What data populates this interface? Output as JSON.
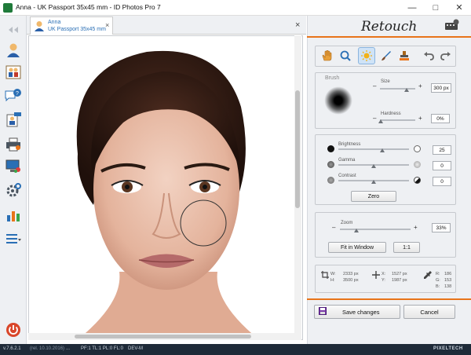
{
  "window": {
    "title": "Anna - UK Passport 35x45 mm - ID Photos Pro 7"
  },
  "tab": {
    "name": "Anna",
    "subtitle": "UK Passport 35x45 mm",
    "close": "×"
  },
  "canvas_close": "×",
  "panel": {
    "title": "Retouch",
    "brush": {
      "label": "Brush",
      "size_label": "Size",
      "size_value": "300 px",
      "hardness_label": "Hardness",
      "hardness_value": "0%"
    },
    "adjust": {
      "brightness_label": "Brightness",
      "brightness_value": "25",
      "gamma_label": "Gamma",
      "gamma_value": "0",
      "contrast_label": "Contrast",
      "contrast_value": "0",
      "zero_button": "Zero"
    },
    "zoom": {
      "label": "Zoom",
      "value": "33%",
      "fit_button": "Fit in Window",
      "one_button": "1:1"
    },
    "info": {
      "w_label": "W:",
      "w_value": "2333 px",
      "h_label": "H:",
      "h_value": "3500 px",
      "x_label": "X:",
      "x_value": "1527 px",
      "y_label": "Y:",
      "y_value": "1987 px",
      "r_label": "R:",
      "r_value": "186",
      "g_label": "G:",
      "g_value": "153",
      "b_label": "B:",
      "b_value": "138"
    },
    "save_button": "Save changes",
    "cancel_button": "Cancel"
  },
  "status": {
    "version": "v.7.6.2.1",
    "date": "(rel. 10.10.2016)",
    "dots": "...",
    "pf": "PF:1  TL:1  PL:0  FL:0",
    "dev": "DEV-M",
    "brand": "PIXELTECH"
  },
  "colors": {
    "accent": "#e8741a",
    "statusbar": "#1e2a38"
  }
}
